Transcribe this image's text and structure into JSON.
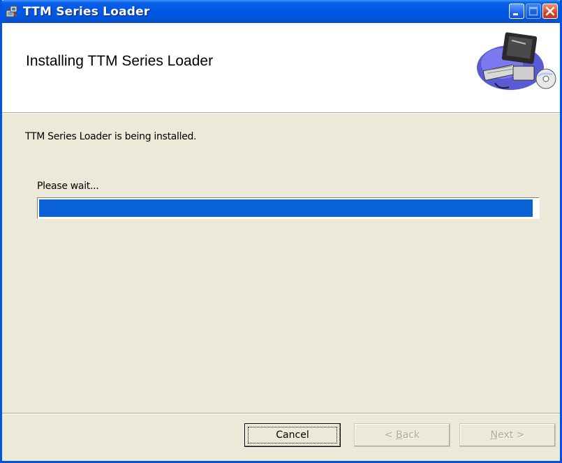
{
  "window": {
    "title": "TTM Series Loader"
  },
  "banner": {
    "heading": "Installing TTM Series Loader",
    "art_icon": "computer-with-cd-icon"
  },
  "content": {
    "status": "TTM Series Loader is being installed.",
    "wait_label": "Please wait...",
    "progress_fraction": 0.99
  },
  "buttons": {
    "cancel": "Cancel",
    "back_prefix": "< ",
    "back_access": "B",
    "back_rest": "ack",
    "next_access": "N",
    "next_rest": "ext >"
  },
  "colors": {
    "titlebar": "#0058e6",
    "progress": "#0a63d6",
    "dialog_bg": "#ece9d8"
  }
}
